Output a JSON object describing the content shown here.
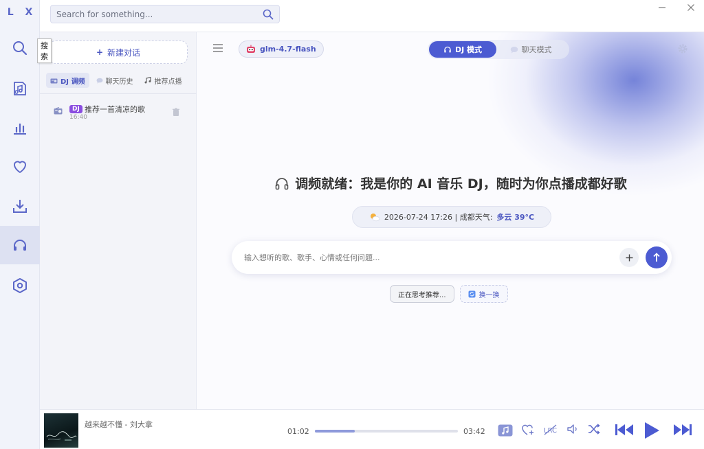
{
  "app": {
    "logo": "L X"
  },
  "search": {
    "placeholder": "Search for something..."
  },
  "rail": {
    "tooltip": "搜索",
    "items": [
      {
        "name": "search",
        "icon": "search-icon"
      },
      {
        "name": "music-library",
        "icon": "music-note-icon"
      },
      {
        "name": "charts",
        "icon": "bar-chart-icon"
      },
      {
        "name": "favorites",
        "icon": "heart-icon"
      },
      {
        "name": "downloads",
        "icon": "download-icon"
      },
      {
        "name": "dj",
        "icon": "headphones-icon",
        "active": true
      },
      {
        "name": "settings",
        "icon": "hexagon-settings-icon"
      }
    ]
  },
  "sidebar": {
    "new_chat": "新建对话",
    "tabs": [
      {
        "label": "DJ 调频",
        "active": true
      },
      {
        "label": "聊天历史"
      },
      {
        "label": "推荐点播"
      }
    ],
    "sessions": [
      {
        "badge": "DJ",
        "title": "推荐一首清凉的歌",
        "time": "16:40"
      }
    ]
  },
  "header": {
    "model": "glm-4.7-flash",
    "modes": [
      {
        "label": "DJ 模式",
        "active": true
      },
      {
        "label": "聊天模式"
      }
    ]
  },
  "main": {
    "headline": "调频就绪：我是你的 AI 音乐 DJ，随时为你点播成都好歌",
    "weather": {
      "date": "2026-07-24 17:26 | 成都天气:",
      "condition": "多云 39°C"
    },
    "input_placeholder": "输入想听的歌、歌手、心情或任何问题...",
    "chips": {
      "thinking": "正在思考推荐...",
      "refresh": "换一换"
    }
  },
  "player": {
    "song": "越来越不懂 - 刘大拿",
    "current_time": "01:02",
    "total_time": "03:42",
    "progress": 0.28
  },
  "colors": {
    "accent": "#4c5bd2",
    "badge": "#8a4de0",
    "rail_bg": "#f1f3fa"
  }
}
